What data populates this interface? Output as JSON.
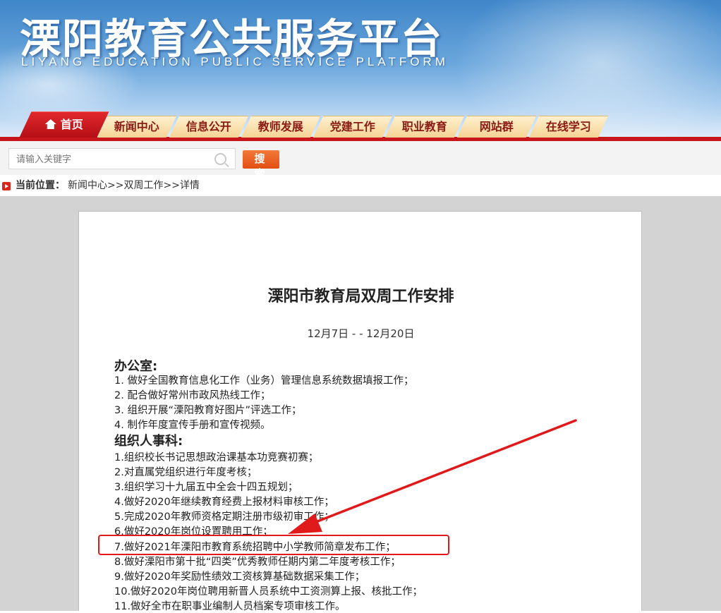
{
  "header": {
    "title": "溧阳教育公共服务平台",
    "subtitle": "LIYANG EDUCATION PUBLIC SERVICE PLATFORM"
  },
  "nav": {
    "items": [
      {
        "label": "首页",
        "icon": "home-icon"
      },
      {
        "label": "新闻中心"
      },
      {
        "label": "信息公开"
      },
      {
        "label": "教师发展"
      },
      {
        "label": "党建工作"
      },
      {
        "label": "职业教育"
      },
      {
        "label": "网站群"
      },
      {
        "label": "在线学习"
      }
    ],
    "accent": "#c8161d"
  },
  "search": {
    "placeholder": "请输入关键字",
    "button_label": "搜 索"
  },
  "breadcrumb": {
    "label": "当前位置：",
    "path": "新闻中心>>双周工作>>详情"
  },
  "article": {
    "title": "溧阳市教育局双周工作安排",
    "date": "12月7日 -  - 12月20日",
    "sections": [
      {
        "heading": "办公室:",
        "items": [
          "1. 做好全国教育信息化工作（业务）管理信息系统数据填报工作；",
          "2. 配合做好常州市政风热线工作；",
          "3. 组织开展“溧阳教育好图片”评选工作；",
          "4. 制作年度宣传手册和宣传视频。"
        ]
      },
      {
        "heading": "组织人事科:",
        "items": [
          "1.组织校长书记思想政治课基本功竞赛初赛；",
          "2.对直属党组织进行年度考核；",
          "3.组织学习十九届五中全会十四五规划；",
          "4.做好2020年继续教育经费上报材料审核工作；",
          "5.完成2020年教师资格定期注册市级初审工作；",
          "6.做好2020年岗位设置聘用工作；",
          "7.做好2021年溧阳市教育系统招聘中小学教师简章发布工作；",
          "8.做好溧阳市第十批“四类”优秀教师任期内第二年度考核工作；",
          "9.做好2020年奖励性绩效工资核算基础数据采集工作；",
          "10.做好2020年岗位聘用新晋人员系统中工资测算上报、核批工作；",
          "11.做好全市在职事业编制人员档案专项审核工作。"
        ]
      }
    ]
  },
  "annotation": {
    "highlight_color": "#e01a1a",
    "highlighted_item": "7.做好2021年溧阳市教育系统招聘中小学教师简章发布工作；"
  }
}
